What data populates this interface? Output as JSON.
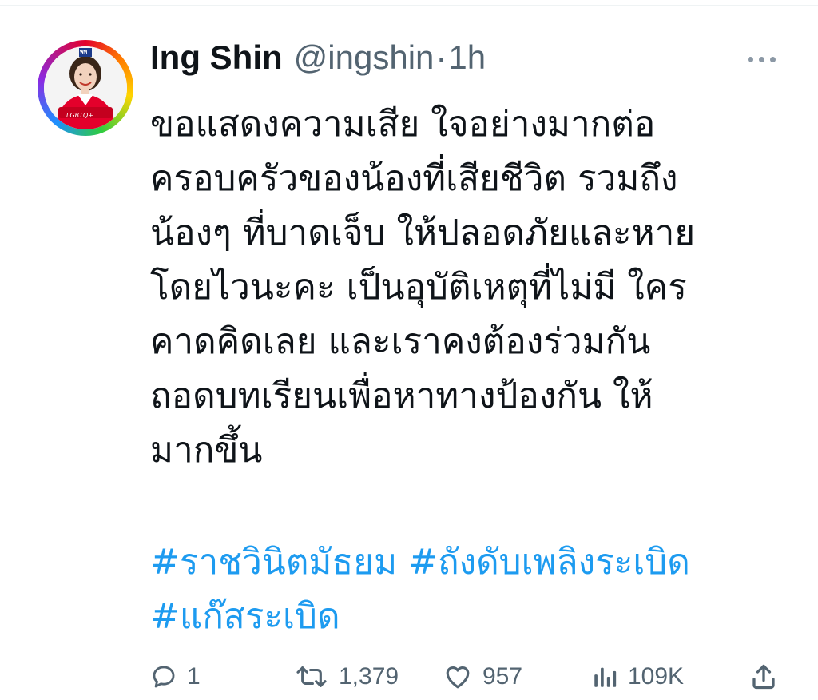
{
  "tweet": {
    "display_name": "Ing Shin",
    "handle": "@ingshin",
    "separator": "·",
    "time": "1h",
    "avatar": {
      "badge_text": "พท",
      "caption": "LGBTQ+",
      "ring_colors": [
        "#e4002b",
        "#ff7a00",
        "#ffd400",
        "#2ecc40",
        "#1e90ff",
        "#8a2be2"
      ]
    },
    "body_lines": [
      "ขอแสดงความเสีย ใจอย่างมากต่อ",
      "ครอบครัวของน้องที่เสียชีวิต รวมถึง",
      "น้องๆ ที่บาดเจ็บ ให้ปลอดภัยและหาย",
      "โดยไวนะคะ เป็นอุบัติเหตุที่ไม่มี ใคร",
      "คาดคิดเลย และเราคงต้องร่วมกัน",
      "ถอดบทเรียนเพื่อหาทางป้องกัน ให้",
      "มากขึ้น"
    ],
    "hashtags": [
      "#ราชวินิตมัธยม",
      "#ถังดับเพลิงระเบิด",
      "#แก๊สระเบิด"
    ],
    "actions": {
      "reply_count": "1",
      "retweet_count": "1,379",
      "like_count": "957",
      "views_count": "109K"
    },
    "colors": {
      "text": "#0f1419",
      "secondary": "#536471",
      "hashtag": "#1d9bf0",
      "party_red": "#e4002b"
    },
    "icons": [
      "more-icon",
      "reply-icon",
      "retweet-icon",
      "like-icon",
      "views-icon",
      "share-icon"
    ]
  }
}
